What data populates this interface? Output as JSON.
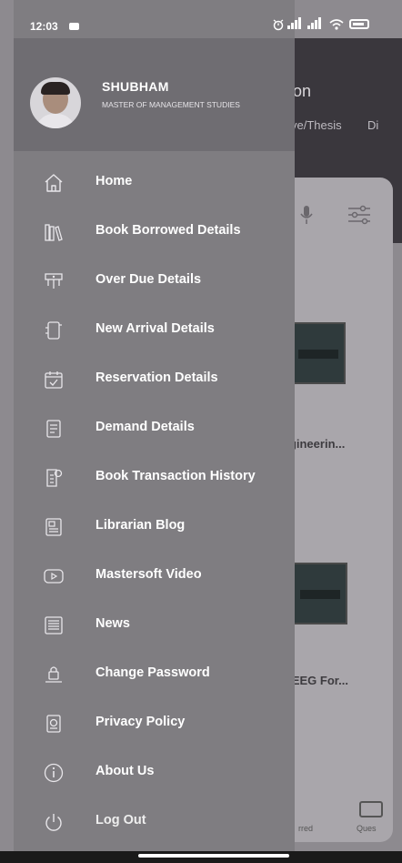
{
  "status_bar": {
    "time": "12:03"
  },
  "background_app": {
    "header_title": "on",
    "header_tab_1": "ve/Thesis",
    "header_tab_2": "Di",
    "book_1_title": "ngineerin...",
    "book_2_title": "e EEG For...",
    "bottom_label_1": "rred",
    "bottom_label_2": "Ques"
  },
  "drawer": {
    "user": {
      "name": "SHUBHAM",
      "course": "MASTER OF MANAGEMENT STUDIES"
    },
    "menu_items": [
      {
        "label": "Home",
        "icon": "home-icon"
      },
      {
        "label": "Book Borrowed Details",
        "icon": "books-icon"
      },
      {
        "label": "Over Due Details",
        "icon": "overdue-icon"
      },
      {
        "label": "New Arrival Details",
        "icon": "new-arrival-icon"
      },
      {
        "label": "Reservation Details",
        "icon": "calendar-check-icon"
      },
      {
        "label": "Demand Details",
        "icon": "document-icon"
      },
      {
        "label": "Book Transaction History",
        "icon": "transaction-history-icon"
      },
      {
        "label": "Librarian Blog",
        "icon": "blog-icon"
      },
      {
        "label": "Mastersoft Video",
        "icon": "video-icon"
      },
      {
        "label": "News",
        "icon": "news-icon"
      },
      {
        "label": "Change Password",
        "icon": "password-lock-icon"
      },
      {
        "label": "Privacy Policy",
        "icon": "privacy-icon"
      },
      {
        "label": "About Us",
        "icon": "info-icon"
      },
      {
        "label": "Log Out",
        "icon": "power-icon"
      }
    ]
  }
}
